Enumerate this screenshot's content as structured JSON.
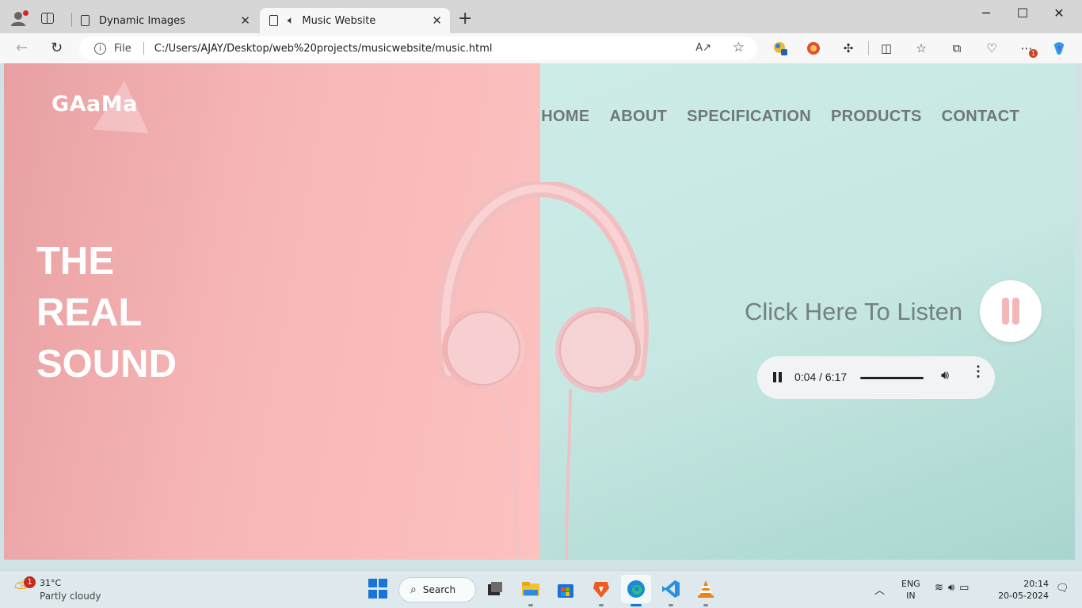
{
  "browser": {
    "tabs": [
      {
        "title": "Dynamic Images",
        "active": false
      },
      {
        "title": "Music Website",
        "active": true
      }
    ],
    "address": {
      "scheme_label": "File",
      "url": "C:/Users/AJAY/Desktop/web%20projects/musicwebsite/music.html"
    },
    "extension_badge": "1"
  },
  "page": {
    "logo": "GAaMa",
    "nav": [
      "HOME",
      "ABOUT",
      "SPECIFICATION",
      "PRODUCTS",
      "CONTACT"
    ],
    "hero_lines": [
      "THE",
      "REAL",
      "SOUND"
    ],
    "listen_text": "Click Here To Listen",
    "audio": {
      "current_time": "0:04",
      "duration": "6:17",
      "time_display": "0:04 / 6:17",
      "state": "playing"
    },
    "colors": {
      "left_panel": "#f7b6b6",
      "right_panel": "#c6e7e2",
      "nav_text": "#6f7876",
      "hero_text": "#ffffff",
      "pause_bars": "#f3b7b9"
    }
  },
  "taskbar": {
    "weather": {
      "temp": "31°C",
      "desc": "Partly cloudy",
      "badge": "1"
    },
    "search_label": "Search",
    "lang": [
      "ENG",
      "IN"
    ],
    "time": "20:14",
    "date": "20-05-2024",
    "apps": [
      "start-icon",
      "search",
      "task-view-icon",
      "file-explorer-icon",
      "store-icon",
      "brave-icon",
      "edge-icon",
      "vscode-icon",
      "vlc-icon"
    ]
  }
}
